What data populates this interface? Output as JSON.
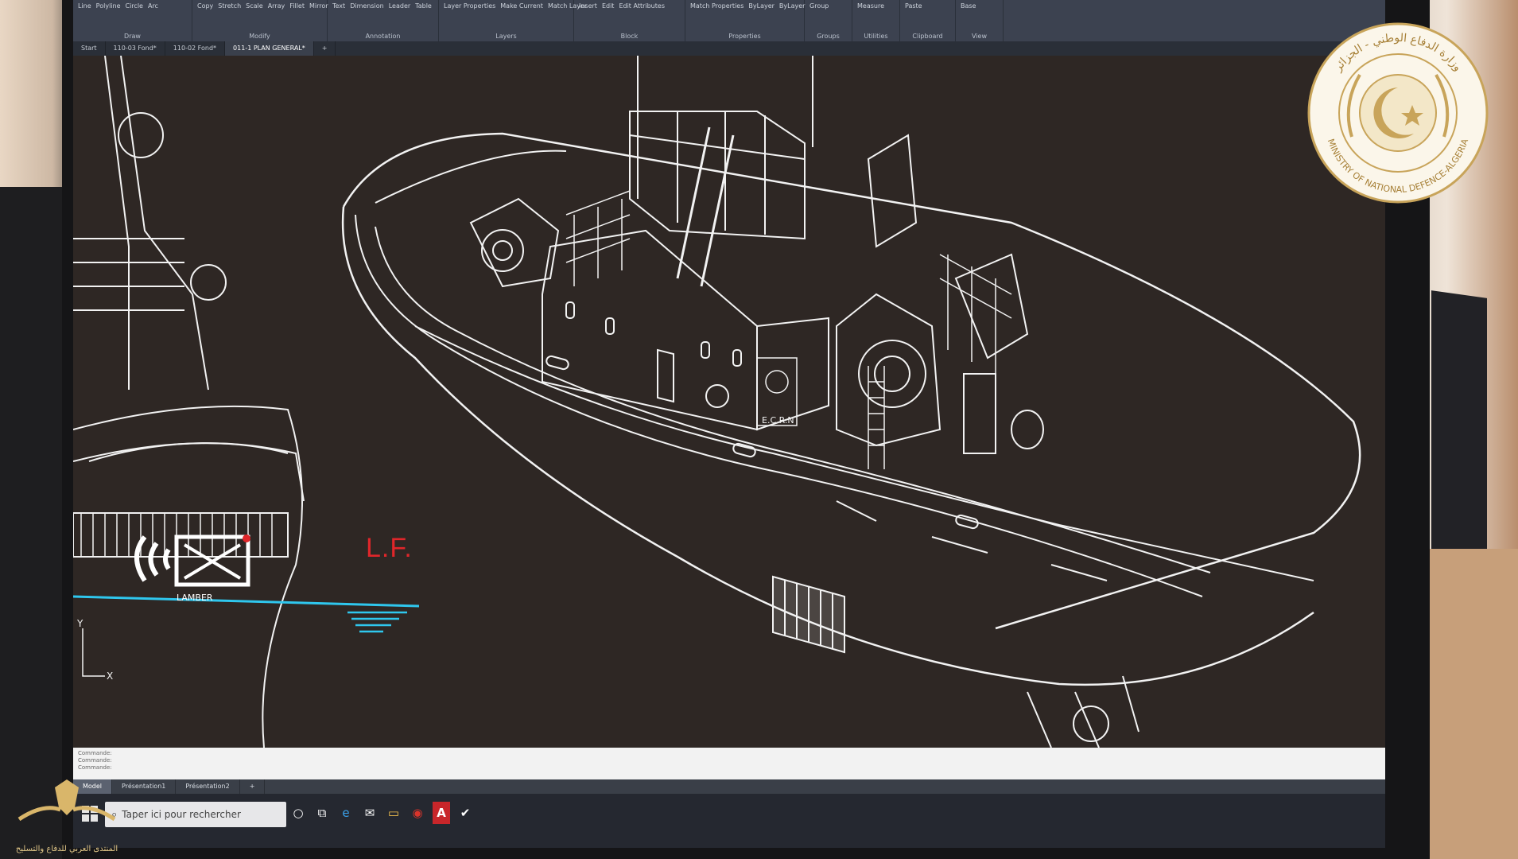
{
  "ribbon": {
    "groups": [
      {
        "label": "Draw",
        "tools": [
          "Line",
          "Polyline",
          "Circle",
          "Arc"
        ]
      },
      {
        "label": "Modify",
        "tools": [
          "Copy",
          "Stretch",
          "Scale",
          "Array",
          "Fillet",
          "Mirror"
        ]
      },
      {
        "label": "Annotation",
        "tools": [
          "Text",
          "Dimension",
          "Leader",
          "Table"
        ]
      },
      {
        "label": "Layers",
        "tools": [
          "Layer Properties",
          "Make Current",
          "Match Layer"
        ]
      },
      {
        "label": "Block",
        "tools": [
          "Insert",
          "Edit",
          "Edit Attributes"
        ]
      },
      {
        "label": "Properties",
        "tools": [
          "Match Properties",
          "ByLayer",
          "ByLayer"
        ]
      },
      {
        "label": "Groups",
        "tools": [
          "Group"
        ]
      },
      {
        "label": "Utilities",
        "tools": [
          "Measure"
        ]
      },
      {
        "label": "Clipboard",
        "tools": [
          "Paste"
        ]
      },
      {
        "label": "View",
        "tools": [
          "Base"
        ]
      }
    ]
  },
  "file_tabs": [
    "Start",
    "110-03 Fond*",
    "110-02 Fond*",
    "011-1 PLAN GENERAL*",
    "+"
  ],
  "drawing": {
    "waterline_label": "L.F.",
    "hull_badge": "E.C.R.N",
    "watermark_text": "LAMBER",
    "axis_y": "Y",
    "axis_x": "X"
  },
  "command_history": [
    "Commande:",
    "Commande:",
    "Commande:"
  ],
  "layout_tabs": [
    "Model",
    "Présentation1",
    "Présentation2",
    "+"
  ],
  "taskbar": {
    "search_placeholder": "Taper ici pour rechercher",
    "apps": [
      {
        "name": "task-view-icon",
        "glyph": "○"
      },
      {
        "name": "multitask-icon",
        "glyph": "⧉"
      },
      {
        "name": "edge-icon",
        "glyph": "e"
      },
      {
        "name": "mail-icon",
        "glyph": "✉"
      },
      {
        "name": "explorer-icon",
        "glyph": "▭"
      },
      {
        "name": "acrobat-icon",
        "glyph": "◉"
      },
      {
        "name": "autocad-icon",
        "glyph": "A"
      },
      {
        "name": "pin-icon",
        "glyph": "✔"
      }
    ]
  },
  "overlay": {
    "ministry_arabic": "وزارة الدفاع الوطني - الجزائر",
    "ministry_english": "MINISTRY OF NATIONAL DEFENCE-ALGERIA",
    "forum_watermark": "المنتدى العربي للدفاع والتسليح"
  },
  "colors": {
    "cad_background": "#2e2724",
    "lines": "#f2f2f2",
    "waterline": "#2fc7ee",
    "label_red": "#e0262a",
    "seal_gold": "#c8a45a"
  }
}
